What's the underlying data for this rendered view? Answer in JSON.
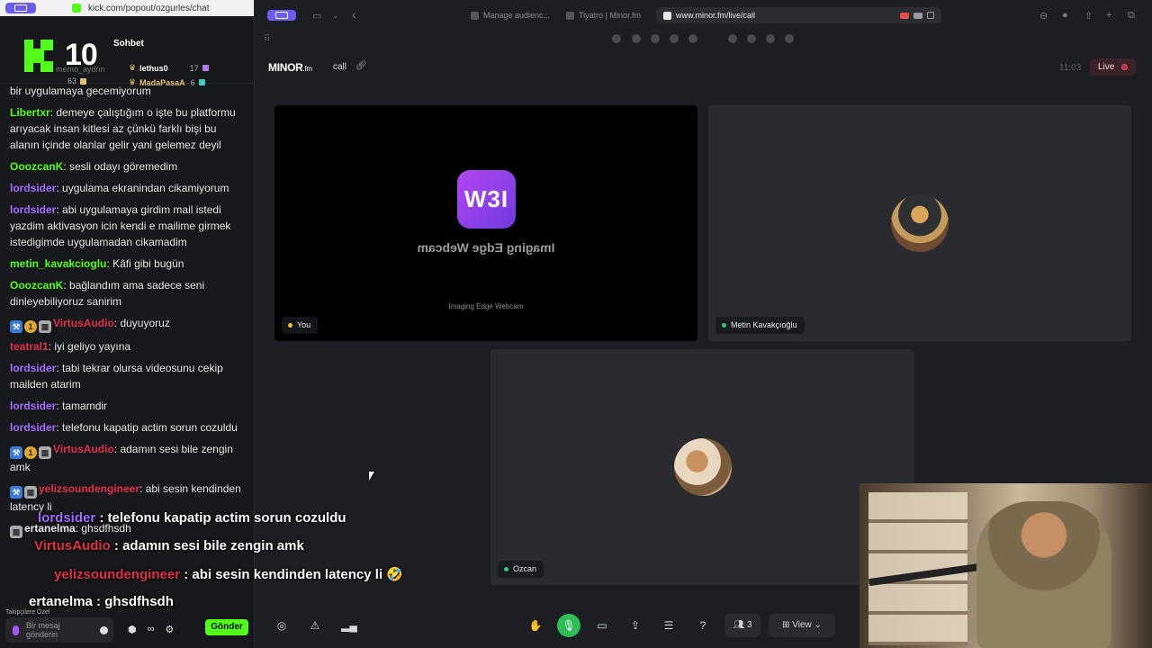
{
  "chat_window": {
    "url": "kick.com/popout/ozgurles/chat",
    "logo_number": "10",
    "title": "Sohbet",
    "leaders": [
      {
        "name": "memo_aydnn",
        "count": "63"
      },
      {
        "name": "lethus0",
        "count": "17"
      },
      {
        "name": "MadaPasaA",
        "count": "6"
      }
    ],
    "messages": [
      {
        "user": "",
        "text": "bir uygulamaya gecemiyorum",
        "color": "#e4e4e6",
        "badges": []
      },
      {
        "user": "Libertxr",
        "text": "demeye çalıştığım o işte bu platformu arıyacak insan kitlesi az çünkü farklı bişi bu alanın içinde olanlar gelir yani gelemez deyil",
        "color": "#53fc18",
        "badges": []
      },
      {
        "user": "OoozcanK",
        "text": "sesli odayı göremedim",
        "color": "#53fc18",
        "badges": []
      },
      {
        "user": "lordsider",
        "text": "uygulama ekranindan cikamiyorum",
        "color": "#a36bff",
        "badges": []
      },
      {
        "user": "lordsider",
        "text": "abi uygulamaya girdim mail istedi yazdim aktivasyon icin kendi e mailime girmek istedigimde uygulamadan cikamadim",
        "color": "#a36bff",
        "badges": []
      },
      {
        "user": "metin_kavakcioglu",
        "text": "Kâfi gibi bugün",
        "color": "#53fc18",
        "badges": []
      },
      {
        "user": "OoozcanK",
        "text": "bağlandım ama sadece seni dinleyebiliyoruz sanirim",
        "color": "#53fc18",
        "badges": []
      },
      {
        "user": "VirtusAudio",
        "text": "duyuyoruz",
        "color": "#e0304a",
        "badges": [
          "blue",
          "gold",
          "grid"
        ]
      },
      {
        "user": "teatral1",
        "text": "iyi geliyo yayına",
        "color": "#e0304a",
        "badges": []
      },
      {
        "user": "lordsider",
        "text": "tabi tekrar olursa videosunu cekip mailden atarim",
        "color": "#a36bff",
        "badges": []
      },
      {
        "user": "lordsider",
        "text": "tamamdir",
        "color": "#a36bff",
        "badges": []
      },
      {
        "user": "lordsider",
        "text": "telefonu kapatip actim sorun cozuldu",
        "color": "#a36bff",
        "badges": []
      },
      {
        "user": "VirtusAudio",
        "text": "adamın sesi bile zengin amk",
        "color": "#e0304a",
        "badges": [
          "blue",
          "gold",
          "grid"
        ]
      },
      {
        "user": "yelizsoundengineer",
        "text": "abi sesin kendinden latency li",
        "color": "#e0304a",
        "badges": [
          "blue",
          "grid"
        ]
      },
      {
        "user": "ertanelma",
        "text": "ghsdfhsdh",
        "color": "#e4e4e6",
        "badges": [
          "grid"
        ]
      }
    ],
    "followers_label": "Takipçilere Özel",
    "input_placeholder": "Bir mesaj gönderin",
    "send_label": "Gönder"
  },
  "browser": {
    "tabs": [
      {
        "label": "Manage audienc...",
        "active": false
      },
      {
        "label": "Tiyatro | Minor.fm",
        "active": false
      },
      {
        "label": "www.minor.fm/live/call",
        "active": true
      }
    ]
  },
  "app": {
    "logo": "MINOR",
    "logo_suffix": ".fm",
    "page": "call",
    "time": "11:03",
    "live_label": "Live"
  },
  "tiles": {
    "you": {
      "name": "You",
      "webcam_logo": "W3I",
      "webcam_mirror_text": "Imaging Edge Webcam",
      "webcam_caption": "Imaging Edge Webcam"
    },
    "metin": {
      "name": "Metin Kavakçıoğlu"
    },
    "ozcan": {
      "name": "Ozcan"
    }
  },
  "controls": {
    "participants_count": "3",
    "view_label": "View"
  },
  "overlay": {
    "lines": [
      {
        "user": "lordsider",
        "text": " : telefonu kapatip actim sorun cozuldu",
        "color": "#a36bff"
      },
      {
        "user": "VirtusAudio",
        "text": " : adamın sesi bile zengin amk",
        "color": "#e0304a"
      },
      {
        "user": "yelizsoundengineer",
        "text": " : abi sesin kendinden latency li 🤣",
        "color": "#e0304a"
      },
      {
        "user": "ertanelma",
        "text": " : ghsdfhsdh",
        "color": "#ffffff"
      }
    ]
  }
}
